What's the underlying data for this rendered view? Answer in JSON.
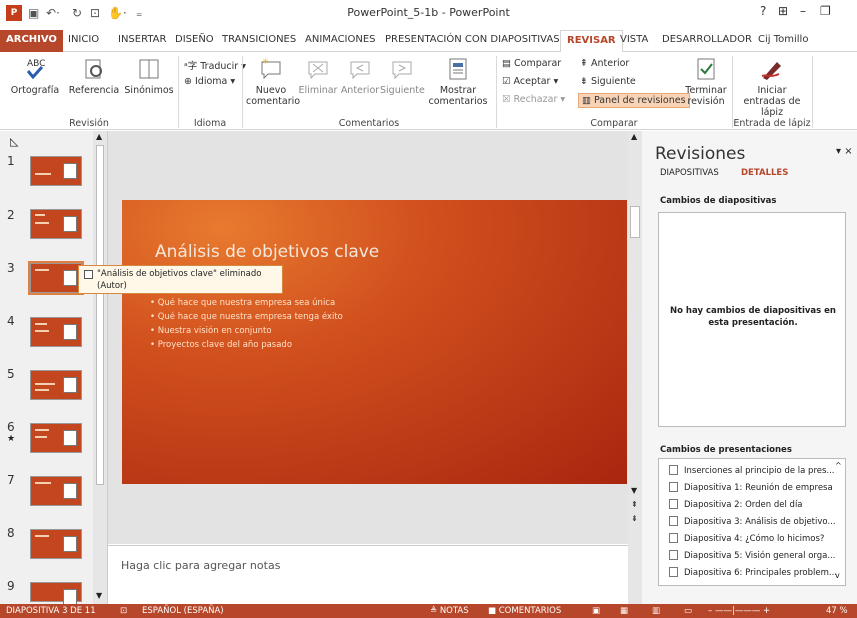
{
  "window": {
    "title": "PowerPoint_5-1b - PowerPoint",
    "user": "Cij Tomillo"
  },
  "tabs": [
    "ARCHIVO",
    "INICIO",
    "INSERTAR",
    "DISEÑO",
    "TRANSICIONES",
    "ANIMACIONES",
    "PRESENTACIÓN CON DIAPOSITIVAS",
    "REVISAR",
    "VISTA",
    "DESARROLLADOR"
  ],
  "ribbon": {
    "revision": {
      "ortografia": "Ortografía",
      "referencia": "Referencia",
      "sinonimos": "Sinónimos",
      "group": "Revisión"
    },
    "idioma": {
      "traducir": "Traducir",
      "idioma": "Idioma",
      "group": "Idioma"
    },
    "comentarios": {
      "nuevo": "Nuevo comentario",
      "eliminar": "Eliminar",
      "anterior": "Anterior",
      "siguiente": "Siguiente",
      "mostrar": "Mostrar comentarios",
      "group": "Comentarios"
    },
    "comparar": {
      "comparar": "Comparar",
      "aceptar": "Aceptar",
      "rechazar": "Rechazar",
      "anterior": "Anterior",
      "siguiente": "Siguiente",
      "panel": "Panel de revisiones",
      "terminar": "Terminar revisión",
      "group": "Comparar"
    },
    "lapiz": {
      "iniciar": "Iniciar entradas de lápiz",
      "group": "Entrada de lápiz"
    }
  },
  "thumbnails": [
    "1",
    "2",
    "3",
    "4",
    "5",
    "6",
    "7",
    "8",
    "9"
  ],
  "slide": {
    "title": "Análisis de objetivos clave",
    "bullets": [
      "Qué hace que nuestra empresa sea única",
      "Qué hace que nuestra empresa tenga éxito",
      "Nuestra visión en conjunto",
      "Proyectos clave del año pasado"
    ]
  },
  "comment_popup": {
    "line1": "\"Análisis de objetivos clave\" eliminado",
    "line2": "(Autor)"
  },
  "notes_placeholder": "Haga clic para agregar notas",
  "revisions": {
    "title": "Revisiones",
    "tab_slides": "DIAPOSITIVAS",
    "tab_details": "DETALLES",
    "slide_changes": "Cambios de diapositivas",
    "no_changes": "No hay cambios de diapositivas en esta presentación.",
    "pres_changes": "Cambios de presentaciones",
    "items": [
      "Inserciones al principio de la pres...",
      "Diapositiva 1: Reunión de empresa",
      "Diapositiva 2: Orden del día",
      "Diapositiva 3: Análisis de objetivo...",
      "Diapositiva 4: ¿Cómo lo hicimos?",
      "Diapositiva 5: Visión general orga...",
      "Diapositiva 6: Principales problem..."
    ]
  },
  "status": {
    "slide": "DIAPOSITIVA 3 DE 11",
    "lang": "ESPAÑOL (ESPAÑA)",
    "notes": "NOTAS",
    "comments": "COMENTARIOS",
    "zoom": "47 %"
  }
}
